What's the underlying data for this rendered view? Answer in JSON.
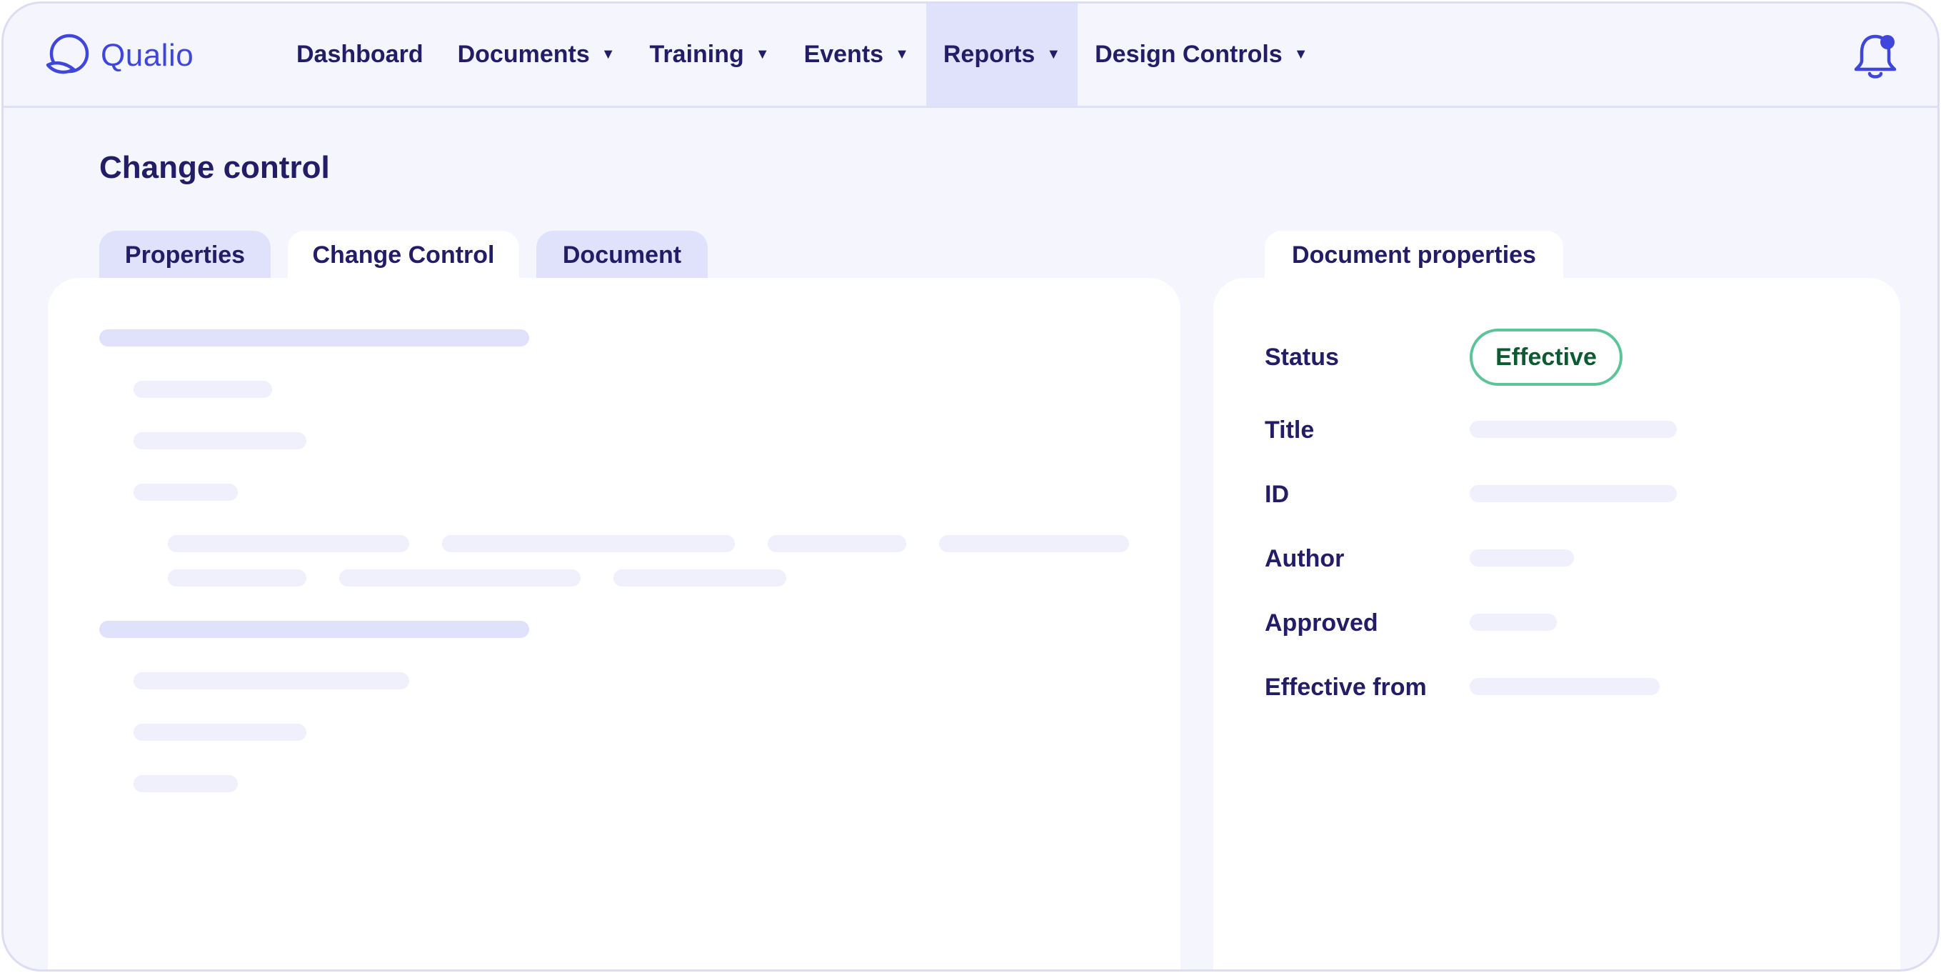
{
  "app": {
    "name": "Qualio"
  },
  "nav": {
    "items": [
      {
        "label": "Dashboard",
        "has_dropdown": false
      },
      {
        "label": "Documents",
        "has_dropdown": true
      },
      {
        "label": "Training",
        "has_dropdown": true
      },
      {
        "label": "Events",
        "has_dropdown": true
      },
      {
        "label": "Reports",
        "has_dropdown": true,
        "active": true
      },
      {
        "label": "Design Controls",
        "has_dropdown": true
      }
    ],
    "caret": "▼",
    "notification_icon": "bell-icon",
    "notification_dot": true
  },
  "page": {
    "title": "Change control"
  },
  "tabs": [
    {
      "label": "Properties",
      "active": false
    },
    {
      "label": "Change Control",
      "active": true
    },
    {
      "label": "Document",
      "active": false
    }
  ],
  "properties_panel": {
    "tab_label": "Document properties",
    "fields": [
      {
        "label": "Status",
        "value": "Effective"
      },
      {
        "label": "Title"
      },
      {
        "label": "ID"
      },
      {
        "label": "Author"
      },
      {
        "label": "Approved"
      },
      {
        "label": "Effective from"
      }
    ]
  },
  "colors": {
    "brand": "#3f46dc",
    "text": "#231c66",
    "background": "#f4f5fd",
    "active_nav": "#e0e2fb",
    "status_border": "#5dc49a",
    "status_text": "#0e5a32"
  }
}
